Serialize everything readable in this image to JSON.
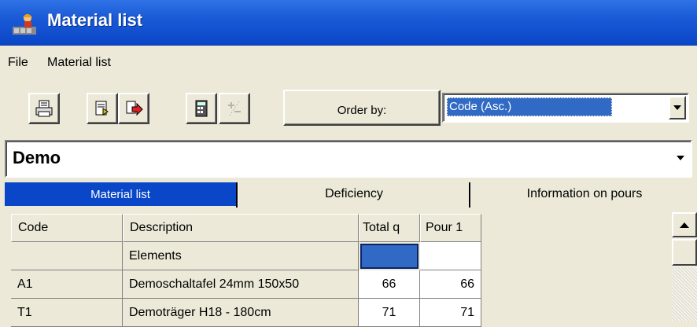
{
  "window": {
    "title": "Material list",
    "icon": "construction-worker-icon"
  },
  "menu": {
    "items": [
      "File",
      "Material list"
    ]
  },
  "toolbar": {
    "buttons": [
      "print-icon",
      "export-document-icon",
      "export-arrow-icon",
      "calculator-icon",
      "plus-minus-icon"
    ],
    "order_by_label": "Order by:",
    "order_by_value": "Code (Asc.)"
  },
  "project": {
    "value": "Demo"
  },
  "tabs": [
    "Material list",
    "Deficiency",
    "Information on pours"
  ],
  "active_tab": "Material list",
  "table": {
    "headers": [
      "Code",
      "Description",
      "Total q",
      "Pour 1"
    ],
    "rows": [
      [
        "",
        "Elements",
        "",
        ""
      ],
      [
        "A1",
        "Demoschaltafel 24mm 150x50",
        "66",
        "66"
      ],
      [
        "T1",
        "Demoträger H18 - 180cm",
        "71",
        "71"
      ]
    ]
  },
  "colors": {
    "title_bar": "#0a46c8",
    "selection": "#316ac5",
    "face": "#ece9d8"
  }
}
